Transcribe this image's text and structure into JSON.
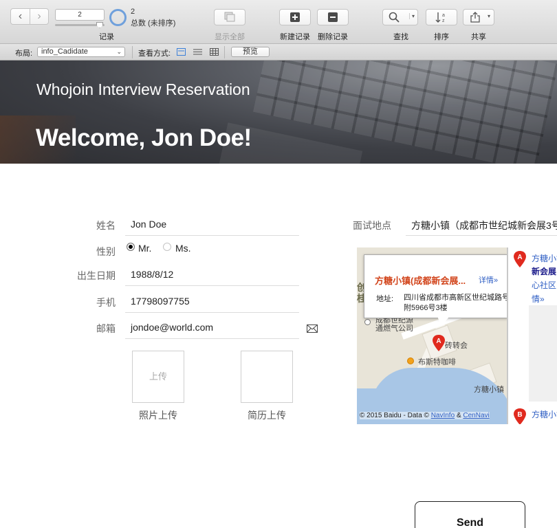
{
  "toolbar": {
    "record_value": "2",
    "record_label": "记录",
    "total_count": "2",
    "total_text": "总数 (未排序)",
    "show_all": "显示全部",
    "new_record": "新建记录",
    "delete_record": "删除记录",
    "find": "查找",
    "sort": "排序",
    "share": "共享"
  },
  "layout_bar": {
    "layout_label": "布局:",
    "layout_value": "info_Cadidate",
    "view_as_label": "查看方式:",
    "preview": "预览"
  },
  "hero": {
    "subtitle": "Whojoin Interview Reservation",
    "title": "Welcome, Jon Doe!"
  },
  "form": {
    "name_label": "姓名",
    "name_value": "Jon Doe",
    "gender_label": "性别",
    "gender_options": [
      "Mr.",
      "Ms."
    ],
    "gender_selected": "Mr.",
    "birth_label": "出生日期",
    "birth_value": "1988/8/12",
    "phone_label": "手机",
    "phone_value": "17798097755",
    "email_label": "邮箱",
    "email_value": "jondoe@world.com",
    "photo_upload_button": "上传",
    "photo_upload_label": "照片上传",
    "resume_upload_label": "简历上传",
    "location_label": "面试地点",
    "location_value": "方糖小镇（成都市世纪城新会展3号",
    "send": "Send"
  },
  "map": {
    "popup_title": "方糖小镇(成都新会展...",
    "popup_more": "详情»",
    "popup_address_key": "地址:",
    "popup_address_value": "四川省成都市高新区世纪城路号附5966号3楼",
    "labels": [
      "成都世纪源通燃气公司",
      "砖转会",
      "布斯特咖啡",
      "方糖小镇"
    ],
    "marker_a": "A",
    "marker_b": "B",
    "copyright_prefix": "© 2015 Baidu - Data ©",
    "copyright_link1": "NavInfo",
    "copyright_amp": "&",
    "copyright_link2": "CenNavi",
    "result_a_name": "方糖小镇",
    "result_a_sub": "新会展",
    "result_a_more": "心社区附",
    "result_a_details": "情»",
    "result_b_name": "方糖小镇"
  },
  "colors": {
    "accent_blue": "#6fa0dc",
    "popup_title": "#d2451c",
    "link": "#2f5fc4",
    "marker_red": "#e02a1e"
  }
}
